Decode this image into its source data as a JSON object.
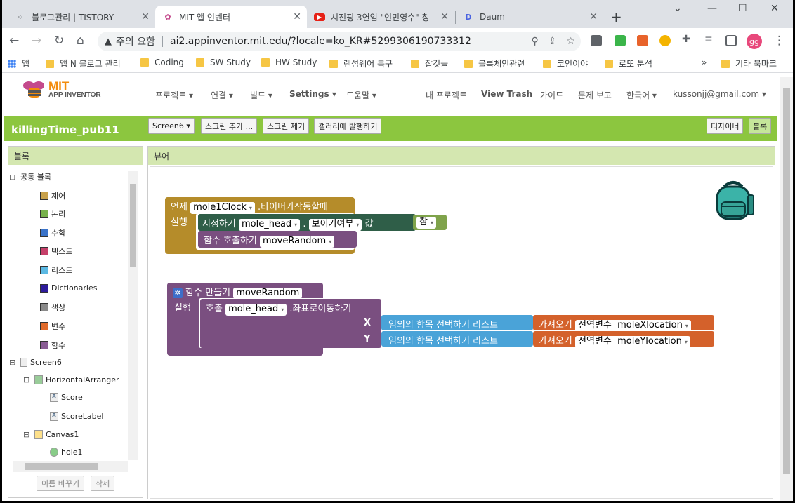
{
  "browser": {
    "tabs": [
      {
        "label": "블로그관리 | TISTORY",
        "icon": "tistory-icon",
        "active": false
      },
      {
        "label": "MIT 앱 인벤터",
        "icon": "app-inventor-icon",
        "active": true
      },
      {
        "label": "시진핑 3연임 \"인민영수\" 칭",
        "icon": "youtube-icon",
        "active": false
      },
      {
        "label": "Daum",
        "icon": "daum-icon",
        "active": false
      }
    ],
    "new_tab": "+",
    "security_label": "주의 요함",
    "url": "ai2.appinventor.mit.edu/?locale=ko_KR#5299306190733312",
    "profile_initials": "gg",
    "bookmarks": [
      {
        "label": "앱"
      },
      {
        "label": "앱 N 블로그 관리"
      },
      {
        "label": "Coding"
      },
      {
        "label": "SW Study"
      },
      {
        "label": "HW Study"
      },
      {
        "label": "랜섬웨어 복구"
      },
      {
        "label": "잡것들"
      },
      {
        "label": "블록체인관련"
      },
      {
        "label": "코인이야"
      },
      {
        "label": "로또 분석"
      }
    ],
    "more_bookmarks": "»",
    "other_bookmarks": "기타 북마크"
  },
  "appinventor": {
    "logo_mit": "MIT",
    "logo_sub": "APP INVENTOR",
    "menu": [
      "프로젝트 ▾",
      "연결 ▾",
      "빌드 ▾",
      "Settings ▾",
      "도움말 ▾"
    ],
    "my_projects": "내 프로젝트",
    "view_trash": "View Trash",
    "guide": "가이드",
    "report": "문제 보고",
    "language": "한국어 ▾",
    "account": "kussonjj@gmail.com ▾",
    "project_name": "killingTime_pub11",
    "screen_select": "Screen6 ▾",
    "add_screen": "스크린 추가 ...",
    "remove_screen": "스크린 제거",
    "publish_gallery": "갤러리에 발행하기",
    "designer": "디자이너",
    "blocks_btn": "블록",
    "colors": {
      "green": "#8cc63f",
      "orange": "#f38c0c"
    }
  },
  "blocks_panel": {
    "header": "블록",
    "builtin": "공통 블록",
    "categories": [
      {
        "label": "제어",
        "color": "#c8a14a"
      },
      {
        "label": "논리",
        "color": "#77b14b"
      },
      {
        "label": "수학",
        "color": "#3a73c9"
      },
      {
        "label": "텍스트",
        "color": "#c6406a"
      },
      {
        "label": "리스트",
        "color": "#5bb9e3"
      },
      {
        "label": "Dictionaries",
        "color": "#2d1b9a"
      },
      {
        "label": "색상",
        "color": "#8a8a8a"
      },
      {
        "label": "변수",
        "color": "#e06a2b"
      },
      {
        "label": "함수",
        "color": "#8a5c95"
      }
    ],
    "components": [
      "Screen6",
      "HorizontalArranger",
      "Score",
      "ScoreLabel",
      "Canvas1",
      "hole1"
    ],
    "rename_btn": "이름 바꾸기",
    "delete_btn": "삭제"
  },
  "viewer": {
    "header": "뷰어",
    "block1": {
      "when": "언제",
      "component": "mole1Clock",
      "event": ".타이머가작동할때",
      "do": "실행",
      "set": "지정하기",
      "set_component": "mole_head",
      "dot": ".",
      "property": "보이기여부",
      "to": "값",
      "value": "참",
      "call": "함수  호출하기",
      "call_name": "moveRandom"
    },
    "block2": {
      "procedure": "함수  만들기",
      "name": "moveRandom",
      "do": "실행",
      "call": "호출",
      "component": "mole_head",
      "method": ".좌표로이동하기",
      "x_label": "X",
      "y_label": "Y",
      "random_item": "임의의  항목  선택하기  리스트",
      "get": "가져오기",
      "global": "전역변수",
      "x_var": "moleXlocation",
      "y_var": "moleYlocation"
    }
  }
}
